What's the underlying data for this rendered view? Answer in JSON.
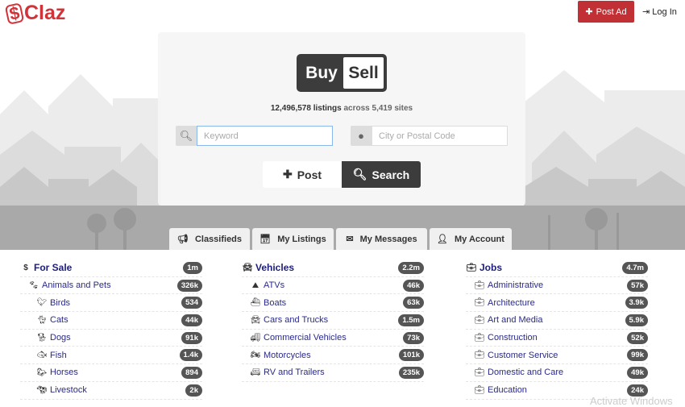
{
  "header": {
    "logo": "Claz",
    "post_ad": "Post Ad",
    "login": "Log In",
    "brand_color": "#c03035"
  },
  "hero": {
    "buy": "Buy",
    "sell": "Sell",
    "listings_count": "12,496,578 listings",
    "across_text": "across 5,419 sites",
    "keyword_placeholder": "Keyword",
    "location_placeholder": "City or Postal Code",
    "post_label": "Post",
    "search_label": "Search"
  },
  "tabs": [
    {
      "label": "Classifieds",
      "icon": "bullhorn-icon"
    },
    {
      "label": "My Listings",
      "icon": "calendar-check-icon"
    },
    {
      "label": "My Messages",
      "icon": "envelope-icon"
    },
    {
      "label": "My Account",
      "icon": "user-icon"
    }
  ],
  "columns": [
    {
      "title": "For Sale",
      "count": "1m",
      "icon": "dollar-icon",
      "items": [
        {
          "label": "Animals and Pets",
          "count": "326k",
          "icon": "paw-icon",
          "level": 1
        },
        {
          "label": "Birds",
          "count": "534",
          "icon": "bird-icon",
          "level": 2
        },
        {
          "label": "Cats",
          "count": "44k",
          "icon": "cat-icon",
          "level": 2
        },
        {
          "label": "Dogs",
          "count": "91k",
          "icon": "dog-icon",
          "level": 2
        },
        {
          "label": "Fish",
          "count": "1.4k",
          "icon": "fish-icon",
          "level": 2
        },
        {
          "label": "Horses",
          "count": "894",
          "icon": "horse-icon",
          "level": 2
        },
        {
          "label": "Livestock",
          "count": "2k",
          "icon": "livestock-icon",
          "level": 2
        }
      ]
    },
    {
      "title": "Vehicles",
      "count": "2.2m",
      "icon": "car-icon",
      "items": [
        {
          "label": "ATVs",
          "count": "46k",
          "icon": "atv-icon",
          "level": 1
        },
        {
          "label": "Boats",
          "count": "63k",
          "icon": "boat-icon",
          "level": 1
        },
        {
          "label": "Cars and Trucks",
          "count": "1.5m",
          "icon": "car-icon",
          "level": 1
        },
        {
          "label": "Commercial Vehicles",
          "count": "73k",
          "icon": "truck-icon",
          "level": 1
        },
        {
          "label": "Motorcycles",
          "count": "101k",
          "icon": "motorcycle-icon",
          "level": 1
        },
        {
          "label": "RV and Trailers",
          "count": "235k",
          "icon": "rv-icon",
          "level": 1
        }
      ]
    },
    {
      "title": "Jobs",
      "count": "4.7m",
      "icon": "briefcase-icon",
      "items": [
        {
          "label": "Administrative",
          "count": "57k",
          "icon": "briefcase-icon",
          "level": 1
        },
        {
          "label": "Architecture",
          "count": "3.9k",
          "icon": "briefcase-icon",
          "level": 1
        },
        {
          "label": "Art and Media",
          "count": "5.9k",
          "icon": "briefcase-icon",
          "level": 1
        },
        {
          "label": "Construction",
          "count": "52k",
          "icon": "briefcase-icon",
          "level": 1
        },
        {
          "label": "Customer Service",
          "count": "99k",
          "icon": "briefcase-icon",
          "level": 1
        },
        {
          "label": "Domestic and Care",
          "count": "49k",
          "icon": "briefcase-icon",
          "level": 1
        },
        {
          "label": "Education",
          "count": "24k",
          "icon": "briefcase-icon",
          "level": 1
        }
      ]
    }
  ],
  "watermark": "Activate Windows"
}
